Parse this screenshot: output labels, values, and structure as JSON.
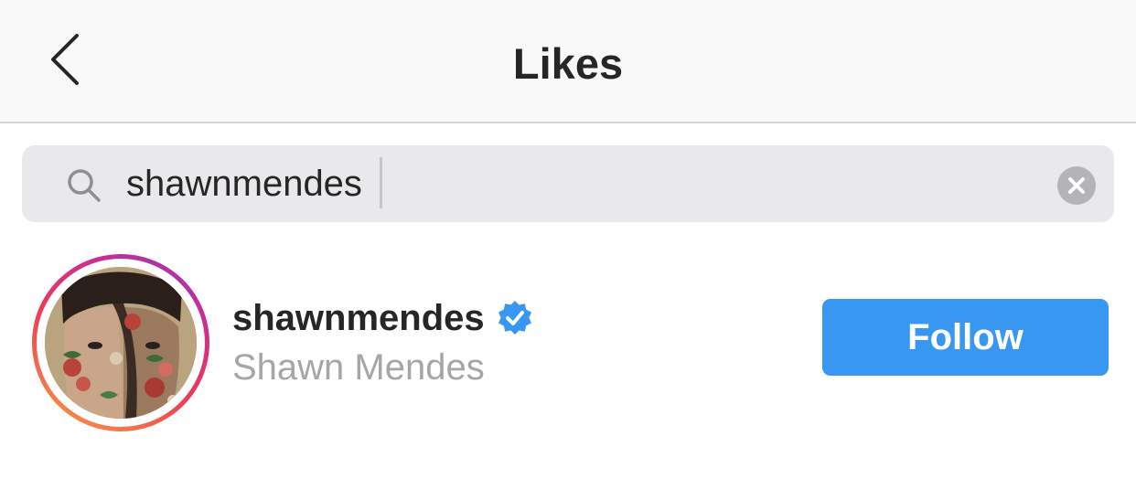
{
  "header": {
    "title": "Likes",
    "back_icon": "chevron-left-icon"
  },
  "search": {
    "value": "shawnmendes",
    "search_icon": "search-icon",
    "clear_icon": "clear-circle-icon"
  },
  "results": [
    {
      "username": "shawnmendes",
      "full_name": "Shawn Mendes",
      "verified": true,
      "has_story_ring": true,
      "follow_label": "Follow"
    }
  ],
  "colors": {
    "header_bg": "#f9f9f9",
    "search_bg": "#e9e9eb",
    "follow_bg": "#3897f0",
    "verified_blue": "#3897f0",
    "secondary_text": "#a6a6a6"
  }
}
